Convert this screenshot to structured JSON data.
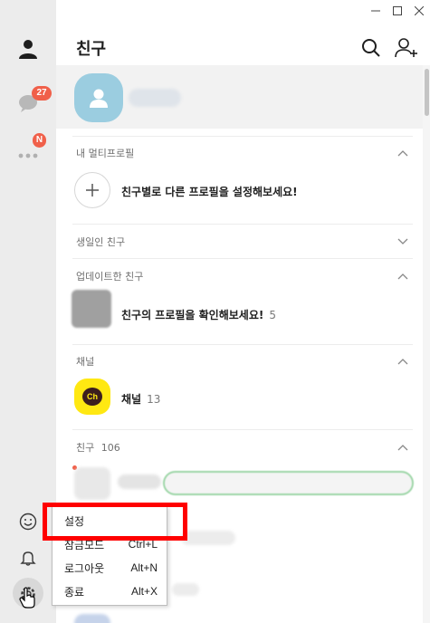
{
  "window_controls": [
    "minimize",
    "maximize",
    "close"
  ],
  "rail": {
    "chats_badge": "27",
    "more_badge": "N"
  },
  "header": {
    "title": "친구"
  },
  "sections": {
    "multi_profile": {
      "title": "내 멀티프로필",
      "row_text": "친구별로 다른 프로필을 설정해보세요!"
    },
    "birthday": {
      "title": "생일인 친구"
    },
    "updated": {
      "title": "업데이트한 친구",
      "row_text": "친구의 프로필을 확인해보세요!",
      "row_count": "5"
    },
    "channel": {
      "title": "채널",
      "row_text": "채널",
      "row_count": "13",
      "icon_label": "Ch"
    },
    "friends": {
      "title": "친구",
      "count": "106"
    }
  },
  "context_menu": {
    "items": [
      {
        "label": "설정",
        "shortcut": ""
      },
      {
        "label": "잠금모드",
        "shortcut": "Ctrl+L"
      },
      {
        "label": "로그아웃",
        "shortcut": "Alt+N"
      },
      {
        "label": "종료",
        "shortcut": "Alt+X"
      }
    ]
  },
  "colors": {
    "badge": "#f0604a",
    "channel_yellow": "#ffe812",
    "highlight": "#ff0000",
    "rail_bg": "#ececec"
  }
}
